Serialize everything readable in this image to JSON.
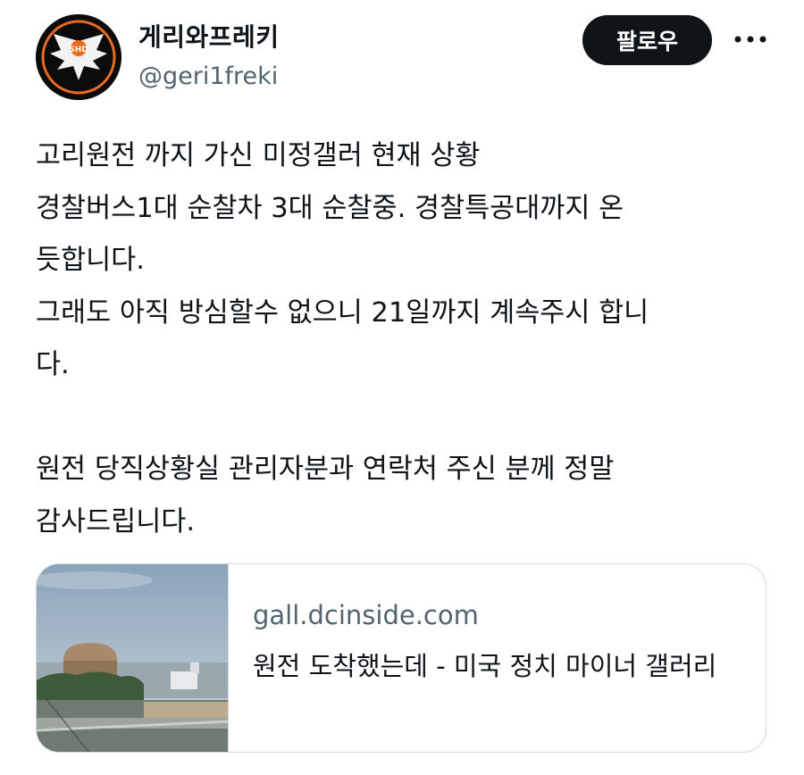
{
  "profile": {
    "display_name": "게리와프레키",
    "handle": "@geri1freki",
    "avatar_icon": "eagle-emblem-icon",
    "avatar_badge_text": "SHD"
  },
  "actions": {
    "follow_label": "팔로우",
    "more_icon": "more-horizontal-icon"
  },
  "tweet": {
    "lines": [
      "고리원전 까지 가신 미정갤러 현재 상황",
      "경찰버스1대 순찰차 3대 순찰중. 경찰특공대까지 온",
      "듯합니다.",
      "그래도 아직 방심할수 없으니 21일까지 계속주시 합니",
      "다.",
      "",
      "원전 당직상황실 관리자분과 연락처 주신 분께 정말",
      "감사드립니다."
    ]
  },
  "card": {
    "domain": "gall.dcinside.com",
    "title": "원전 도착했는데 - 미국 정치 마이너 갤러리",
    "thumbnail": "nuclear-plant-photo"
  },
  "colors": {
    "text": "#0f1419",
    "secondary": "#536471",
    "button_bg": "#0f1419",
    "border": "#cfd9de"
  }
}
